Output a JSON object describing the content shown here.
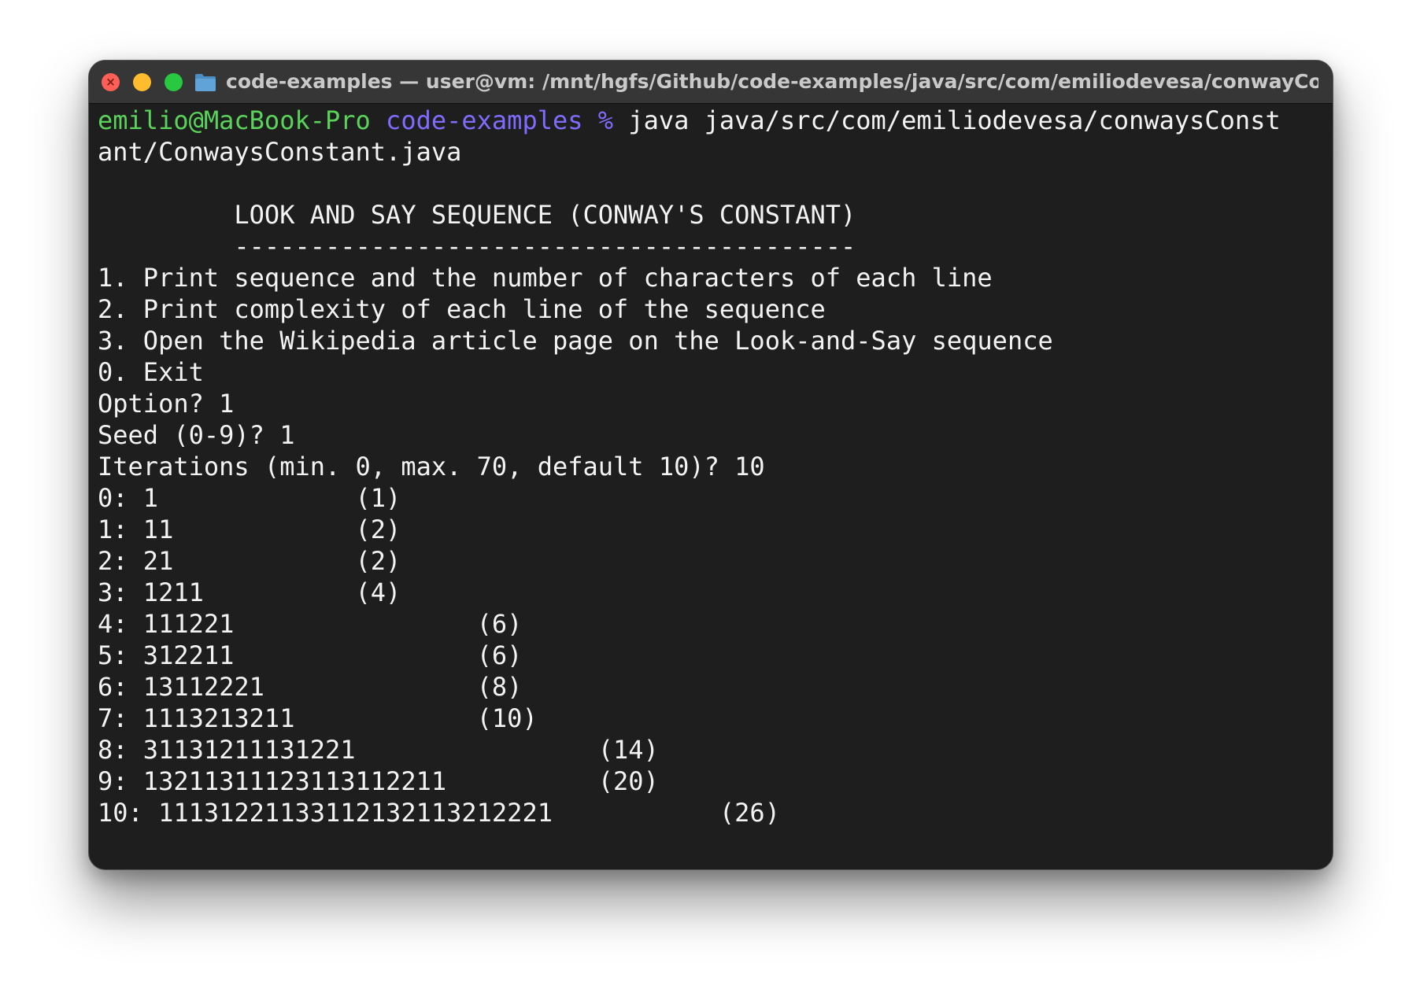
{
  "window": {
    "title": "code-examples — user@vm: /mnt/hgfs/Github/code-examples/java/src/com/emiliodevesa/conwayConstant...",
    "folder_icon": "folder-icon"
  },
  "terminal": {
    "prompt_user": "emilio@MacBook-Pro",
    "prompt_dir": "code-examples",
    "prompt_symbol": "%",
    "command_line1": " java java/src/com/emiliodevesa/conwaysConst",
    "command_line2": "ant/ConwaysConstant.java",
    "header_title": "         LOOK AND SAY SEQUENCE (CONWAY'S CONSTANT)",
    "header_rule": "         -----------------------------------------",
    "menu": [
      "1. Print sequence and the number of characters of each line",
      "2. Print complexity of each line of the sequence",
      "3. Open the Wikipedia article page on the Look-and-Say sequence",
      "0. Exit"
    ],
    "option_prompt": "Option? 1",
    "seed_prompt": "Seed (0-9)? 1",
    "iterations_prompt": "Iterations (min. 0, max. 70, default 10)? 10",
    "sequence": [
      "0: 1             (1)",
      "1: 11            (2)",
      "2: 21            (2)",
      "3: 1211          (4)",
      "4: 111221                (6)",
      "5: 312211                (6)",
      "6: 13112221              (8)",
      "7: 1113213211            (10)",
      "8: 31131211131221                (14)",
      "9: 13211311123113112211          (20)",
      "10: 11131221133112132113212221           (26)"
    ]
  }
}
